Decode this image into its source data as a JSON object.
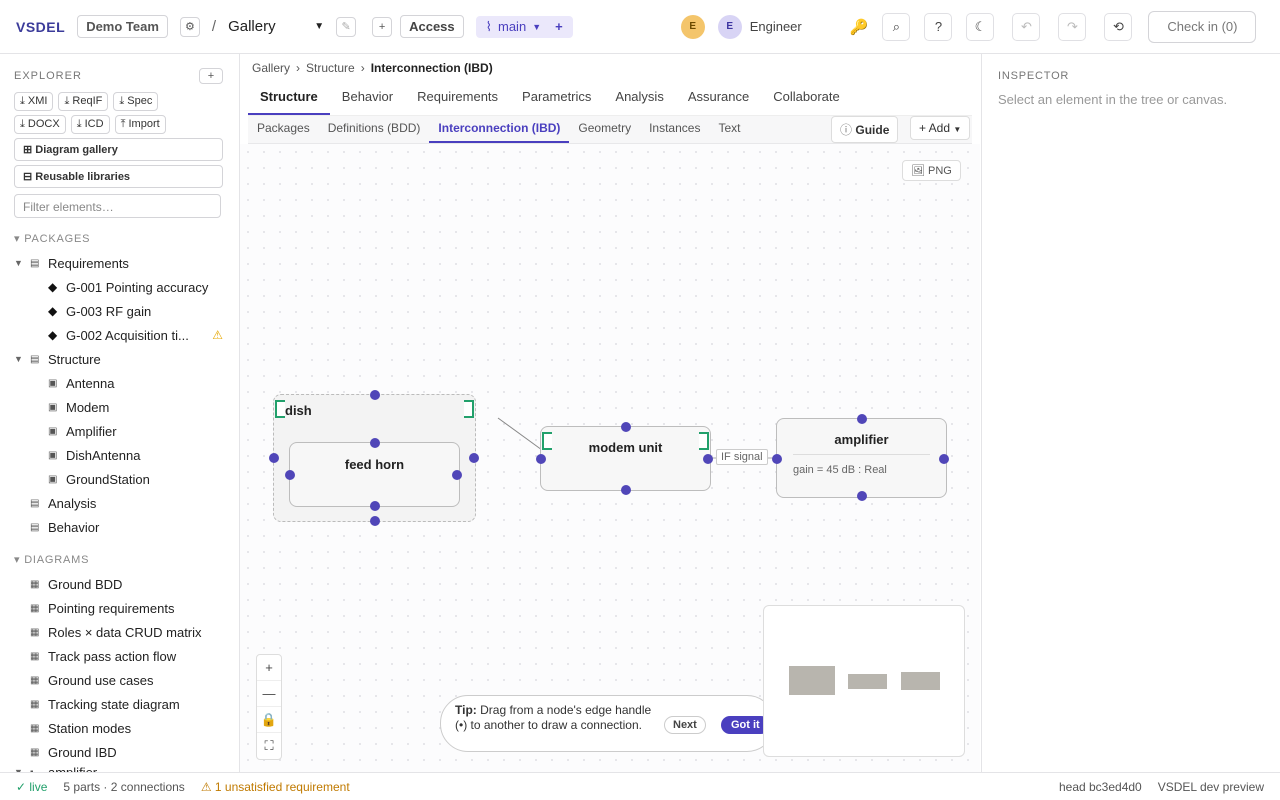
{
  "topbar": {
    "brand": "VSDEL",
    "team": "Demo Team",
    "separator": "/",
    "project": "Gallery",
    "access": "Access",
    "branch": "main",
    "user_initial": "E",
    "user_role": "Engineer",
    "checkin": "Check in (0)"
  },
  "sidebar": {
    "title": "EXPLORER",
    "exports": [
      "XMI",
      "ReqIF",
      "Spec",
      "DOCX",
      "ICD",
      "Import"
    ],
    "diagram_gallery": "Diagram gallery",
    "reusable_libraries": "Reusable libraries",
    "filter_placeholder": "Filter elements…",
    "packages_label": "PACKAGES",
    "diagrams_label": "DIAGRAMS",
    "packages": {
      "requirements": "Requirements",
      "req_items": [
        "G-001 Pointing accuracy",
        "G-003 RF gain",
        "G-002 Acquisition ti..."
      ],
      "structure": "Structure",
      "structure_items": [
        "Antenna",
        "Modem",
        "Amplifier",
        "DishAntenna",
        "GroundStation"
      ],
      "analysis": "Analysis",
      "behavior": "Behavior"
    },
    "diagrams": [
      "Ground BDD",
      "Pointing requirements",
      "Roles × data CRUD matrix",
      "Track pass action flow",
      "Ground use cases",
      "Tracking state diagram",
      "Station modes",
      "Ground IBD"
    ],
    "cut_item": "amplifier"
  },
  "main": {
    "breadcrumb": [
      "Gallery",
      "Structure",
      "Interconnection (IBD)"
    ],
    "tabs": [
      "Structure",
      "Behavior",
      "Requirements",
      "Parametrics",
      "Analysis",
      "Assurance",
      "Collaborate"
    ],
    "subtabs": [
      "Packages",
      "Definitions (BDD)",
      "Interconnection (IBD)",
      "Geometry",
      "Instances",
      "Text"
    ],
    "guide": "Guide",
    "add": "+ Add",
    "png": "PNG"
  },
  "canvas": {
    "nodes": {
      "dish": "dish",
      "feed_horn": "feed horn",
      "modem_unit": "modem unit",
      "amplifier": "amplifier",
      "amplifier_attr": "gain = 45 dB : Real"
    },
    "edge_label": "IF signal",
    "tip_bold": "Tip:",
    "tip_text": "Drag from a node's edge handle (•) to another to draw a connection.",
    "tip_next": "Next",
    "tip_got": "Got it"
  },
  "inspector": {
    "title": "INSPECTOR",
    "hint": "Select an element in the tree or canvas."
  },
  "status": {
    "live": "live",
    "counts": "5 parts · 2 connections",
    "unsatisfied": "1 unsatisfied requirement",
    "head": "head bc3ed4d0",
    "env": "VSDEL dev preview"
  },
  "colors": {
    "accent": "#4a3fbf",
    "port": "#22a06b",
    "warning": "#e6a700"
  }
}
